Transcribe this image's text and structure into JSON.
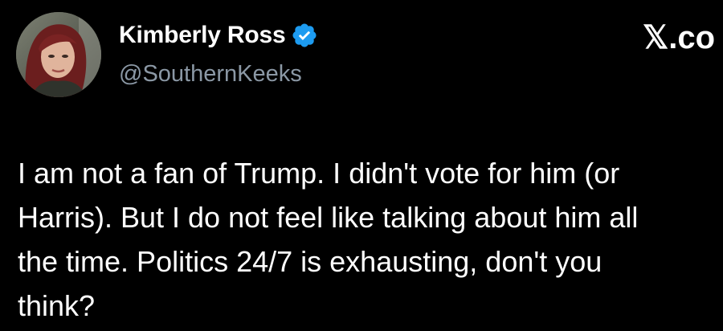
{
  "author": {
    "display_name": "Kimberly Ross",
    "handle": "@SouthernKeeks",
    "verified": true,
    "avatar_icon": "profile-photo"
  },
  "source": {
    "label": "𝕏.co"
  },
  "tweet": {
    "lines": [
      "I am not a fan of Trump. I didn't vote for him (or",
      "Harris). But I do not feel like talking about him all",
      "the time. Politics 24/7 is exhausting, don't you",
      "think?"
    ]
  },
  "colors": {
    "background": "#000000",
    "text": "#ffffff",
    "handle": "#8b98a5",
    "verified_badge": "#1d9bf0"
  }
}
